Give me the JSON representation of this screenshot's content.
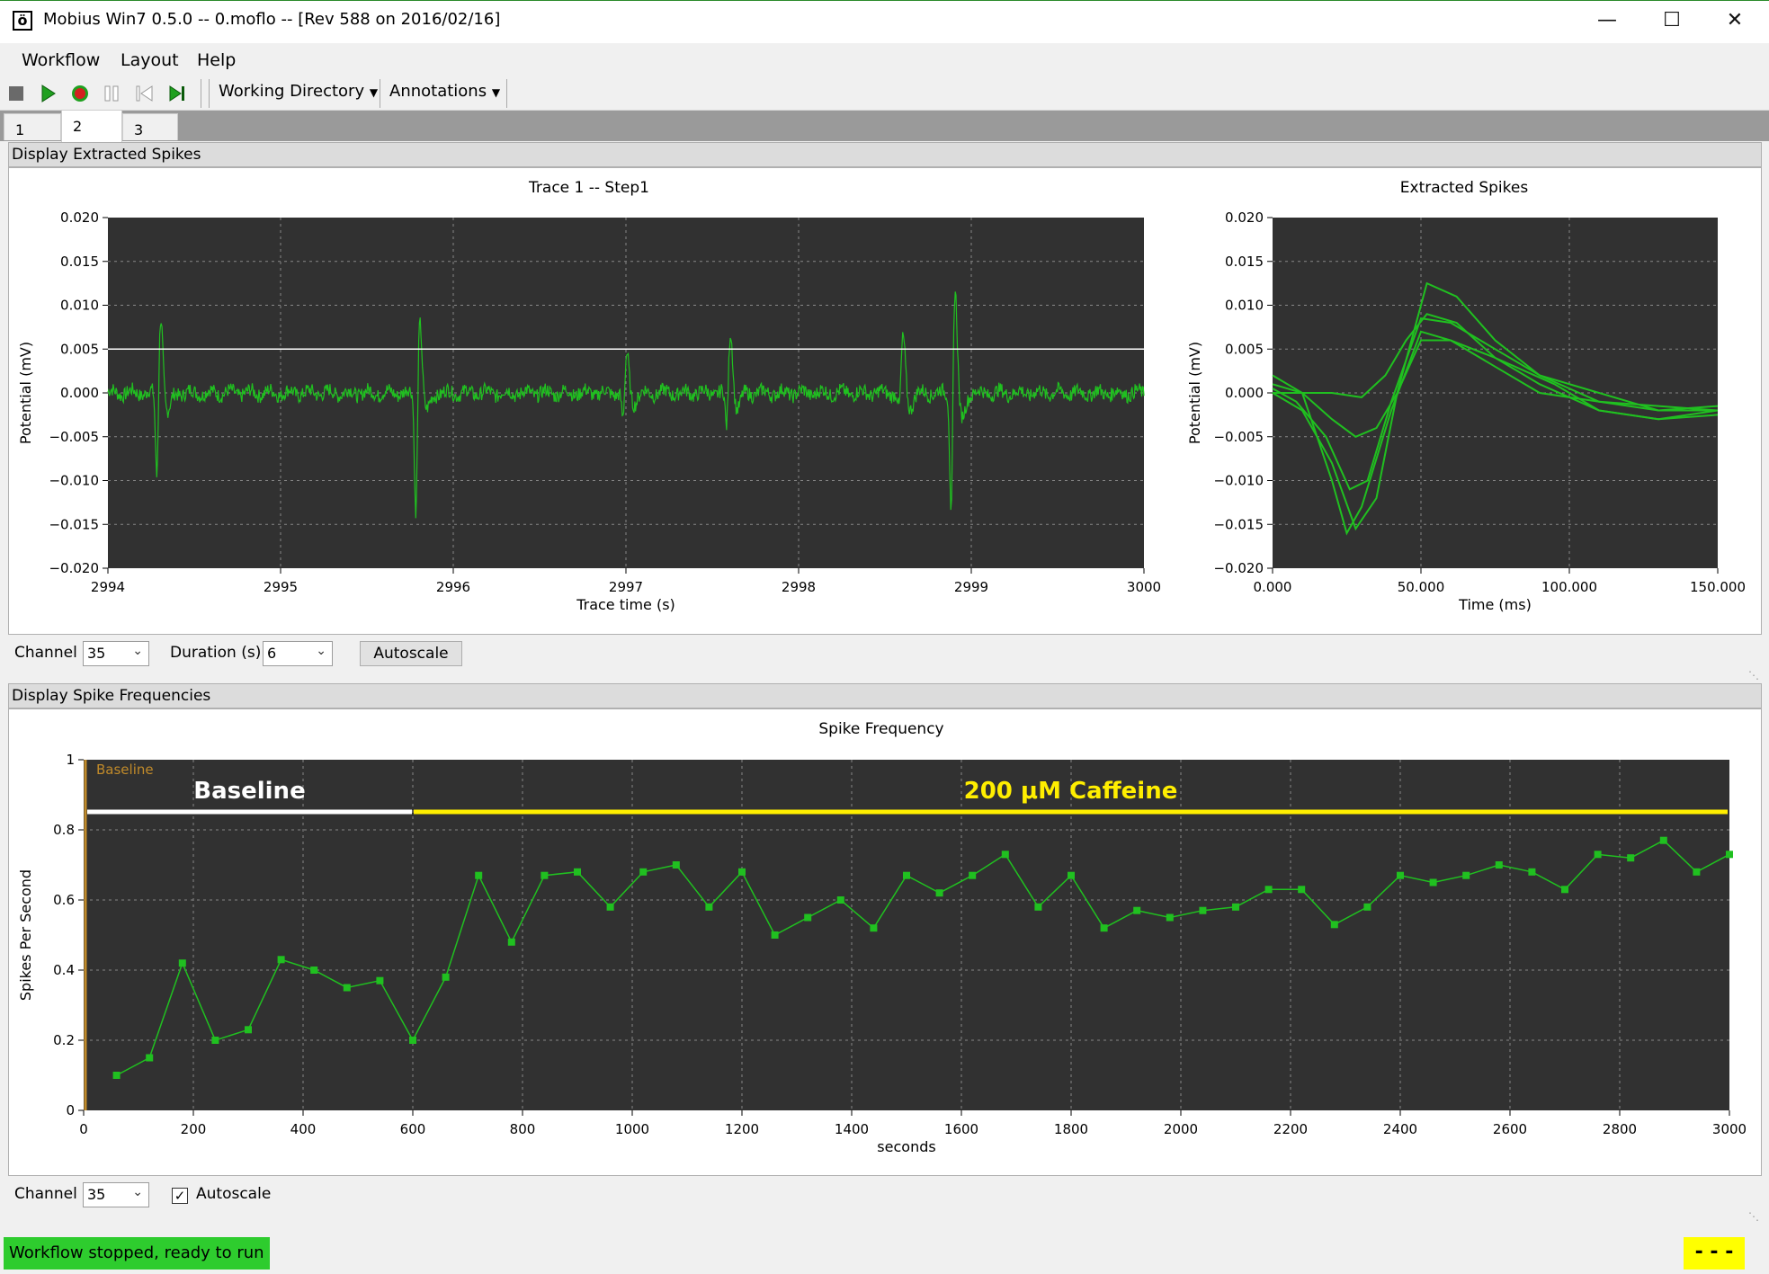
{
  "window": {
    "title": "Mobius Win7 0.5.0 -- 0.moflo -- [Rev 588 on 2016/02/16]",
    "icon_glyph": "ö"
  },
  "menu": {
    "items": [
      "Workflow",
      "Layout",
      "Help"
    ]
  },
  "toolbar": {
    "icons": [
      "stop-icon",
      "play-icon",
      "record-icon",
      "pause-icon",
      "skip-back-icon",
      "step-forward-icon"
    ],
    "working_directory_label": "Working Directory",
    "annotations_label": "Annotations"
  },
  "tabs": [
    {
      "label": "1"
    },
    {
      "label": "2"
    },
    {
      "label": "3"
    }
  ],
  "panel1": {
    "title": "Display Extracted Spikes",
    "channel_label": "Channel",
    "channel_value": "35",
    "duration_label": "Duration (s)",
    "duration_value": "6",
    "autoscale_label": "Autoscale"
  },
  "panel2": {
    "title": "Display Spike Frequencies",
    "channel_label": "Channel",
    "channel_value": "35",
    "autoscale_label": "Autoscale",
    "autoscale_checked": true
  },
  "status": {
    "message": "Workflow stopped, ready to run",
    "indicator": "- - -"
  },
  "colors": {
    "plot_bg": "#313131",
    "trace": "#20c020",
    "grid": "#888888",
    "threshold": "#ffffff",
    "baseline_bar": "#ffffff",
    "caffeine_bar": "#ffee00",
    "baseline_marker": "#c08a2a",
    "status_ok": "#2ecc2e",
    "status_indicator": "#ffff00"
  },
  "chart_data": [
    {
      "type": "line",
      "title": "Trace 1 -- Step1",
      "xlabel": "Trace time (s)",
      "ylabel": "Potential (mV)",
      "xlim": [
        2994,
        3000
      ],
      "ylim": [
        -0.02,
        0.02
      ],
      "x_ticks": [
        "2994",
        "2995",
        "2996",
        "2997",
        "2998",
        "2999",
        "3000"
      ],
      "y_ticks": [
        "0.020",
        "0.015",
        "0.010",
        "0.005",
        "0.000",
        "−0.005",
        "−0.010",
        "−0.015",
        "−0.020"
      ],
      "threshold": 0.005,
      "grid": true,
      "spikes": [
        {
          "t": 2994.3,
          "peak": 0.0095,
          "trough": -0.0115
        },
        {
          "t": 2995.8,
          "peak": 0.009,
          "trough": -0.0158
        },
        {
          "t": 2997.0,
          "peak": 0.0045,
          "trough": -0.004
        },
        {
          "t": 2997.6,
          "peak": 0.0075,
          "trough": -0.0055
        },
        {
          "t": 2998.6,
          "peak": 0.0065,
          "trough": -0.003
        },
        {
          "t": 2998.9,
          "peak": 0.0125,
          "trough": -0.0165
        }
      ]
    },
    {
      "type": "line",
      "title": "Extracted Spikes",
      "xlabel": "Time (ms)",
      "ylabel": "Potential (mV)",
      "xlim": [
        0,
        150
      ],
      "ylim": [
        -0.02,
        0.02
      ],
      "x_ticks": [
        "0.000",
        "50.000",
        "100.000",
        "150.000"
      ],
      "y_ticks": [
        "0.020",
        "0.015",
        "0.010",
        "0.005",
        "0.000",
        "−0.005",
        "−0.010",
        "−0.015",
        "−0.020"
      ],
      "grid": true,
      "series": [
        {
          "x": [
            0,
            10,
            20,
            25,
            30,
            40,
            50,
            60,
            75,
            90,
            110,
            130,
            150
          ],
          "y": [
            0.002,
            0.0,
            -0.01,
            -0.016,
            -0.013,
            -0.002,
            0.007,
            0.006,
            0.003,
            0.0,
            -0.001,
            -0.0015,
            -0.002
          ]
        },
        {
          "x": [
            0,
            10,
            20,
            28,
            35,
            42,
            52,
            62,
            75,
            90,
            110,
            130,
            150
          ],
          "y": [
            0.0,
            -0.002,
            -0.008,
            -0.0155,
            -0.012,
            0.0,
            0.0125,
            0.011,
            0.006,
            0.002,
            -0.001,
            -0.002,
            -0.0015
          ]
        },
        {
          "x": [
            0,
            10,
            20,
            30,
            38,
            45,
            52,
            62,
            75,
            90,
            110,
            130,
            150
          ],
          "y": [
            0.0,
            0.0,
            0.0,
            -0.0005,
            0.002,
            0.006,
            0.009,
            0.008,
            0.004,
            0.001,
            -0.002,
            -0.003,
            -0.0025
          ]
        },
        {
          "x": [
            0,
            8,
            18,
            26,
            32,
            40,
            50,
            60,
            75,
            90,
            110,
            130,
            150
          ],
          "y": [
            0.0005,
            -0.001,
            -0.005,
            -0.011,
            -0.01,
            -0.001,
            0.0085,
            0.008,
            0.005,
            0.002,
            0.0,
            -0.002,
            -0.002
          ]
        },
        {
          "x": [
            0,
            10,
            20,
            28,
            35,
            42,
            50,
            60,
            75,
            95,
            110,
            130,
            150
          ],
          "y": [
            0.001,
            0.0,
            -0.003,
            -0.005,
            -0.004,
            0.0,
            0.006,
            0.006,
            0.004,
            0.001,
            -0.002,
            -0.003,
            -0.002
          ]
        }
      ]
    },
    {
      "type": "line",
      "title": "Spike Frequency",
      "xlabel": "seconds",
      "ylabel": "Spikes Per Second",
      "xlim": [
        0,
        3000
      ],
      "ylim": [
        0,
        1
      ],
      "x_ticks": [
        "0",
        "200",
        "400",
        "600",
        "800",
        "1000",
        "1200",
        "1400",
        "1600",
        "1800",
        "2000",
        "2200",
        "2400",
        "2600",
        "2800",
        "3000"
      ],
      "y_ticks": [
        "1",
        "0.8",
        "0.6",
        "0.4",
        "0.2",
        "0"
      ],
      "grid": true,
      "marker_label": "Baseline",
      "annotations": [
        {
          "label": "Baseline",
          "start": 0,
          "end": 600
        },
        {
          "label": "200 μM Caffeine",
          "start": 600,
          "end": 3000
        }
      ],
      "x": [
        60,
        120,
        180,
        240,
        300,
        360,
        420,
        480,
        540,
        600,
        660,
        720,
        780,
        840,
        900,
        960,
        1020,
        1080,
        1140,
        1200,
        1260,
        1320,
        1380,
        1440,
        1500,
        1560,
        1620,
        1680,
        1740,
        1800,
        1860,
        1920,
        1980,
        2040,
        2100,
        2160,
        2220,
        2280,
        2340,
        2400,
        2460,
        2520,
        2580,
        2640,
        2700,
        2760,
        2820,
        2880,
        2940,
        3000
      ],
      "y": [
        0.1,
        0.15,
        0.42,
        0.2,
        0.23,
        0.43,
        0.4,
        0.35,
        0.37,
        0.2,
        0.38,
        0.67,
        0.48,
        0.67,
        0.68,
        0.58,
        0.68,
        0.7,
        0.58,
        0.68,
        0.5,
        0.55,
        0.6,
        0.52,
        0.67,
        0.62,
        0.67,
        0.73,
        0.58,
        0.67,
        0.52,
        0.57,
        0.55,
        0.57,
        0.58,
        0.63,
        0.63,
        0.53,
        0.58,
        0.67,
        0.65,
        0.67,
        0.7,
        0.68,
        0.63,
        0.73,
        0.72,
        0.77,
        0.68,
        0.73
      ]
    }
  ]
}
